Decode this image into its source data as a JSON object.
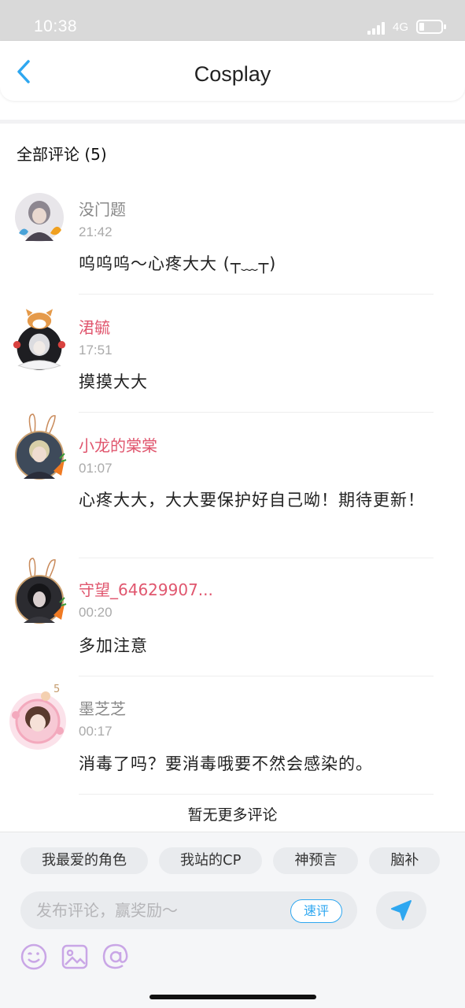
{
  "status_bar": {
    "time": "10:38",
    "network": "4G",
    "battery_level": 0.15
  },
  "header": {
    "title": "Cosplay"
  },
  "comments_header": {
    "label": "全部评论 (5)"
  },
  "comments": [
    {
      "name": "没门题",
      "name_color": "#888888",
      "time": "21:42",
      "text": "呜呜呜～心疼大大 (┬﹏┬)"
    },
    {
      "name": "涒毓",
      "name_color": "#e0566e",
      "time": "17:51",
      "text": "摸摸大大"
    },
    {
      "name": "小龙的棠棠",
      "name_color": "#e0566e",
      "time": "01:07",
      "text": "心疼大大，大大要保护好自己呦！期待更新！"
    },
    {
      "name": "守望_64629907...",
      "name_color": "#e0566e",
      "time": "00:20",
      "text": "多加注意"
    },
    {
      "name": "墨芝芝",
      "name_color": "#888888",
      "time": "00:17",
      "text": "消毒了吗？要消毒哦要不然会感染的。"
    }
  ],
  "footer_note": "暂无更多评论",
  "quick_topics": [
    "我最爱的角色",
    "我站的CP",
    "神预言",
    "脑补"
  ],
  "composer": {
    "placeholder": "发布评论，赢奖励～",
    "quick_review_label": "速评"
  },
  "avatar_badge": "5",
  "colors": {
    "accent": "#2ea7f0",
    "pink_name": "#e0566e",
    "tool_icon": "#c9a6e6"
  },
  "icons": [
    "back-arrow-icon",
    "signal-icon",
    "battery-icon",
    "send-icon",
    "emoji-icon",
    "image-icon",
    "at-icon"
  ]
}
